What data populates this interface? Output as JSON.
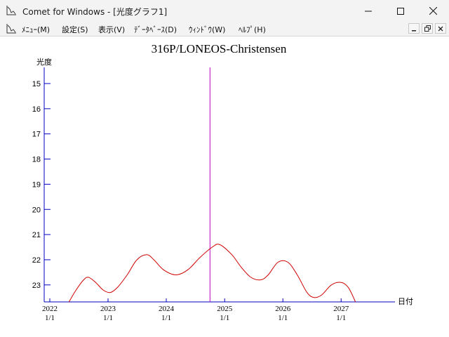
{
  "window": {
    "title": "Comet for Windows - [光度グラフ1]"
  },
  "menu": {
    "items": [
      {
        "label": "ﾒﾆｭｰ(M)"
      },
      {
        "label": "設定(S)"
      },
      {
        "label": "表示(V)"
      },
      {
        "label": "ﾃﾞｰﾀﾍﾞｰｽ(D)"
      },
      {
        "label": "ｳｨﾝﾄﾞｳ(W)"
      },
      {
        "label": "ﾍﾙﾌﾟ(H)"
      }
    ]
  },
  "colors": {
    "axis": "#0000c0",
    "curve": "#d00000",
    "marker": "#c000c0",
    "text": "#000000"
  },
  "chart_data": {
    "type": "line",
    "title": "316P/LONEOS-Christensen",
    "ylabel": "光度",
    "xlabel": "日付",
    "y_inverted": true,
    "ylim": [
      14.5,
      23.7
    ],
    "xlim": [
      "2022-01-01",
      "2027-07-01"
    ],
    "yticks": [
      15,
      16,
      17,
      18,
      19,
      20,
      21,
      22,
      23
    ],
    "xticks": [
      {
        "date": "2022-01-01",
        "year": "2022",
        "md": "1/1"
      },
      {
        "date": "2023-01-01",
        "year": "2023",
        "md": "1/1"
      },
      {
        "date": "2024-01-01",
        "year": "2024",
        "md": "1/1"
      },
      {
        "date": "2025-01-01",
        "year": "2025",
        "md": "1/1"
      },
      {
        "date": "2026-01-01",
        "year": "2026",
        "md": "1/1"
      },
      {
        "date": "2027-01-01",
        "year": "2027",
        "md": "1/1"
      }
    ],
    "current_date": "2024-10-01",
    "series": [
      {
        "points": [
          {
            "x": "2022-05-01",
            "y": 23.7
          },
          {
            "x": "2022-06-15",
            "y": 23.2
          },
          {
            "x": "2022-08-01",
            "y": 22.8
          },
          {
            "x": "2022-09-01",
            "y": 22.7
          },
          {
            "x": "2022-10-15",
            "y": 22.9
          },
          {
            "x": "2022-12-01",
            "y": 23.2
          },
          {
            "x": "2023-01-15",
            "y": 23.3
          },
          {
            "x": "2023-03-01",
            "y": 23.1
          },
          {
            "x": "2023-05-01",
            "y": 22.6
          },
          {
            "x": "2023-07-01",
            "y": 22.0
          },
          {
            "x": "2023-09-01",
            "y": 21.8
          },
          {
            "x": "2023-10-15",
            "y": 22.0
          },
          {
            "x": "2023-12-15",
            "y": 22.4
          },
          {
            "x": "2024-03-01",
            "y": 22.6
          },
          {
            "x": "2024-05-15",
            "y": 22.4
          },
          {
            "x": "2024-08-01",
            "y": 21.9
          },
          {
            "x": "2024-10-15",
            "y": 21.5
          },
          {
            "x": "2024-12-01",
            "y": 21.4
          },
          {
            "x": "2025-02-15",
            "y": 21.8
          },
          {
            "x": "2025-04-15",
            "y": 22.3
          },
          {
            "x": "2025-06-15",
            "y": 22.7
          },
          {
            "x": "2025-08-15",
            "y": 22.8
          },
          {
            "x": "2025-10-01",
            "y": 22.6
          },
          {
            "x": "2025-12-01",
            "y": 22.1
          },
          {
            "x": "2026-02-01",
            "y": 22.1
          },
          {
            "x": "2026-04-01",
            "y": 22.6
          },
          {
            "x": "2026-06-01",
            "y": 23.3
          },
          {
            "x": "2026-07-15",
            "y": 23.5
          },
          {
            "x": "2026-09-01",
            "y": 23.4
          },
          {
            "x": "2026-11-01",
            "y": 23.0
          },
          {
            "x": "2027-01-01",
            "y": 22.9
          },
          {
            "x": "2027-02-15",
            "y": 23.1
          },
          {
            "x": "2027-04-01",
            "y": 23.7
          }
        ]
      }
    ]
  }
}
